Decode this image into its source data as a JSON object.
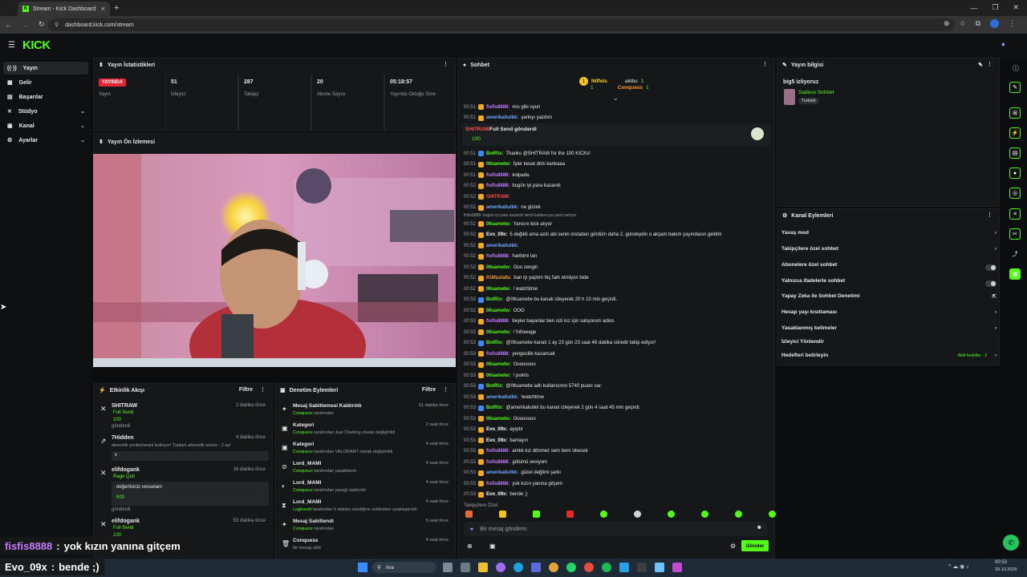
{
  "browser": {
    "tab_title": "Stream - Kick Dashboard",
    "new_tab": "+",
    "url": "dashboard.kick.com/stream",
    "window_controls": [
      "—",
      "❐",
      "✕"
    ]
  },
  "kick": {
    "logo": "KICK"
  },
  "sidebar": {
    "items": [
      {
        "label": "Yayın",
        "icon": "((·))"
      },
      {
        "label": "Gelir",
        "icon": "▦"
      },
      {
        "label": "Başarılar",
        "icon": "▤"
      },
      {
        "label": "Stüdyo",
        "icon": "✕"
      },
      {
        "label": "Kanal",
        "icon": "▣"
      },
      {
        "label": "Ayarlar",
        "icon": "⚙"
      }
    ]
  },
  "stats": {
    "title": "Yayın İstatistikleri",
    "items": [
      {
        "value": "YAYINDA",
        "label": "Yayın"
      },
      {
        "value": "51",
        "label": "İzleyici"
      },
      {
        "value": "287",
        "label": "Takipçi"
      },
      {
        "value": "20",
        "label": "Abone Sayısı"
      },
      {
        "value": "05:18:57",
        "label": "Yayında Olduğu Süre"
      }
    ]
  },
  "preview": {
    "title": "Yayın Ön İzlemesi"
  },
  "activity": {
    "title": "Etkinlik Akışı",
    "filter": "Filtre",
    "items": [
      {
        "name": "SHITRAW",
        "sub": "Full Send",
        "amount": "100",
        "note": "gönderdi",
        "time": "2 dakika önce"
      },
      {
        "name": "7Hidden",
        "sub": "abonelik yenilemesini kutluyor! Toplam abonelik süresi - 2 ay!",
        "amount": "x",
        "note": "",
        "time": "4 dakika önce"
      },
      {
        "name": "elifdogank",
        "sub": "Rage Quit",
        "amount": "500",
        "note": "gönderdi",
        "msg": "değerlisiniz vesselam",
        "time": "16 dakika önce"
      },
      {
        "name": "elifdogank",
        "sub": "Full Send",
        "amount": "100",
        "note": "gönderdi",
        "time": "53 dakika önce"
      }
    ]
  },
  "moderation": {
    "title": "Denetim Eylemleri",
    "filter": "Filtre",
    "items": [
      {
        "title": "Mesaj Sabitlemesi Kaldırıldı",
        "user": "Conquess",
        "detail": " tarafından",
        "time": "51 dakika önce"
      },
      {
        "title": "Kategori",
        "user": "Conquess",
        "detail": " tarafından Just Chatting olarak değiştirildi",
        "time": "2 saat önce"
      },
      {
        "title": "Kategori",
        "user": "Conquess",
        "detail": " tarafından VALORANT olarak değiştirildi",
        "time": "4 saat önce"
      },
      {
        "title": "Lord_MAMI",
        "user": "Conquess",
        "detail": " tarafından yasaklandı",
        "time": "4 saat önce"
      },
      {
        "title": "Lord_MAMI",
        "user": "Conquess",
        "detail": " tarafından yasağı kaldırıldı",
        "time": "4 saat önce"
      },
      {
        "title": "Lord_MAMI",
        "user": "Lugburett",
        "detail": " tarafından 5 dakika süreliğine sohbetten uzaklaştırıldı",
        "time": "4 saat önce"
      },
      {
        "title": "Mesaj Sabitlendi",
        "user": "Conquess",
        "detail": " tarafından",
        "time": "5 saat önce"
      },
      {
        "title": "Conquess",
        "user": "",
        "detail": "bir mesajı sildi",
        "time": "4 saat önce"
      }
    ]
  },
  "chat": {
    "title": "Sohbet",
    "leaders": [
      {
        "name": "Niffels",
        "count": "1"
      },
      {
        "name": "aktbu",
        "count": "1"
      },
      {
        "name": "Conquess",
        "count": "1"
      }
    ],
    "gift": {
      "user": "SHITRAW",
      "text": "Full Send gönderdi",
      "amount": "100"
    },
    "reply_hint": "fisfis8888: bugün iyi para kazandı isimli kullanıcıya yanıt veriyor",
    "followers_only": "Takipçilere Özel",
    "input_placeholder": "Bir mesaj gönderin",
    "send": "Gönder",
    "messages": [
      {
        "t": "00:51",
        "u": "fisfis8888:",
        "c": "pink",
        "m": "mis gibi oyun"
      },
      {
        "t": "00:51",
        "u": "amerikaliutkk:",
        "c": "blue",
        "m": "şarkıyı yazdım"
      },
      {
        "t": "00:51",
        "u": "BotRix:",
        "c": "green",
        "m": "Thanks @SHITRAW for the 100 KICKs!"
      },
      {
        "t": "00:51",
        "u": "06sametw:",
        "c": "green",
        "m": "İşler kesat dimi kankaaa"
      },
      {
        "t": "00:51",
        "u": "fisfis8888:",
        "c": "pink",
        "m": "kolpada"
      },
      {
        "t": "00:52",
        "u": "fisfis8888:",
        "c": "pink",
        "m": "bugün iyi para kazandı"
      },
      {
        "t": "00:52",
        "u": "SHITRAW:",
        "c": "red",
        "m": ""
      },
      {
        "t": "00:52",
        "u": "amerikaliutkk:",
        "c": "blue",
        "m": "ne güzek"
      },
      {
        "t": "00:52",
        "u": "06sametw:",
        "c": "green",
        "m": "Yansını kick alıyor"
      },
      {
        "t": "00:52",
        "u": "Evo_09x:",
        "c": "white",
        "m": "5 değildi ama azdı abi senin instadan gördüm daha 2. gündeydin o akşam bakım yayındasın geldim"
      },
      {
        "t": "00:52",
        "u": "amerikaliutkk:",
        "c": "blue",
        "m": ""
      },
      {
        "t": "00:52",
        "u": "fisfis8888:",
        "c": "pink",
        "m": "haribimi lan"
      },
      {
        "t": "00:52",
        "u": "06sametw:",
        "c": "green",
        "m": "Ooo zengin"
      },
      {
        "t": "00:52",
        "u": "01Mustafa:",
        "c": "orange",
        "m": "ban rp yaptım hiç fark etmiyon bide"
      },
      {
        "t": "00:52",
        "u": "06sametw:",
        "c": "green",
        "m": "! watchtime"
      },
      {
        "t": "00:52",
        "u": "BotRix:",
        "c": "green",
        "m": "@06sametw bu kanalı izleyerek 20 h 10 min geçirdi."
      },
      {
        "t": "00:52",
        "u": "06sametw:",
        "c": "green",
        "m": "OOO"
      },
      {
        "t": "00:53",
        "u": "fisfis8888:",
        "c": "pink",
        "m": "beyler bayanlar ben sizi kız için satıyorum adios"
      },
      {
        "t": "00:53",
        "u": "06sametw:",
        "c": "green",
        "m": "! followage"
      },
      {
        "t": "00:53",
        "u": "BotRix:",
        "c": "green",
        "m": "@06sametw kanalı 1 ay 23 gün 23 saat 46 dakika süredir takip ediyor!"
      },
      {
        "t": "00:53",
        "u": "fisfis8888:",
        "c": "pink",
        "m": "yengecilik kazancak"
      },
      {
        "t": "00:53",
        "u": "06sametw:",
        "c": "green",
        "m": "Oooooooo"
      },
      {
        "t": "00:53",
        "u": "06sametw:",
        "c": "green",
        "m": "! points"
      },
      {
        "t": "00:53",
        "u": "BotRix:",
        "c": "green",
        "m": "@06sametw adlı kullanıcının 5740 puanı var."
      },
      {
        "t": "00:53",
        "u": "amerikaliutkk:",
        "c": "blue",
        "m": "!watchtime"
      },
      {
        "t": "00:53",
        "u": "BotRix:",
        "c": "green",
        "m": "@amerikaliutkk bu kanalı izleyerek 2 gün 4 saat 45 min geçirdi."
      },
      {
        "t": "00:53",
        "u": "06sametw:",
        "c": "green",
        "m": "Oooooooo"
      },
      {
        "t": "00:53",
        "u": "Evo_09x:",
        "c": "white",
        "m": "ayıptır"
      },
      {
        "t": "00:53",
        "u": "Evo_09x:",
        "c": "white",
        "m": "banlayın"
      },
      {
        "t": "00:53",
        "u": "fisfis8888:",
        "c": "pink",
        "m": "amkk kız dönmez sem beni sikecek"
      },
      {
        "t": "00:53",
        "u": "fisfis8888:",
        "c": "pink",
        "m": "götümü seviyom"
      },
      {
        "t": "00:53",
        "u": "amerikaliutkk:",
        "c": "blue",
        "m": "güzel değilmi şarkı"
      },
      {
        "t": "00:53",
        "u": "fisfis8888:",
        "c": "pink",
        "m": "yok kızın yanına gitçem"
      },
      {
        "t": "00:53",
        "u": "Evo_09x:",
        "c": "white",
        "m": "bende ;)"
      }
    ]
  },
  "stream_info": {
    "title": "Yayın bilgisi",
    "stream_title": "big5 izliyoruz",
    "category": "Sadece Sohbet",
    "tag": "Turkish"
  },
  "channel_actions": {
    "title": "Kanal Eylemleri",
    "items": [
      {
        "label": "Yavaş mod",
        "ctrl": "chevron"
      },
      {
        "label": "Takipçilere özel sohbet",
        "ctrl": "chevron"
      },
      {
        "label": "Abonelere özel sohbet",
        "ctrl": "toggle"
      },
      {
        "label": "Yalnızca ifadelerle sohbet",
        "ctrl": "toggle"
      },
      {
        "label": "Yapay Zeka ile Sohbet Denetimi",
        "ctrl": "ext"
      },
      {
        "label": "Hesap yaşı kısıtlaması",
        "ctrl": "chevron"
      },
      {
        "label": "Yasaklanmış kelimeler",
        "ctrl": "chevron"
      },
      {
        "label": "İzleyici Yönlendir",
        "ctrl": "none"
      },
      {
        "label": "Hedefleri belirleyin",
        "ctrl": "chevron"
      }
    ],
    "goals_status": "Aktif hedefler - 2"
  },
  "overlay": [
    {
      "user": "fisfis8888",
      "sep": " : ",
      "msg": "yok kızın yanına gitçem"
    },
    {
      "user": "Evo_09x",
      "sep": " : ",
      "msg": "bende ;)"
    }
  ],
  "taskbar": {
    "search": "Ara",
    "clock": "00:53",
    "date": "29.10.2025"
  },
  "colors": {
    "accent": "#53fc18",
    "bg": "#0b0d0e",
    "panel": "#151719",
    "live": "#e52536"
  }
}
